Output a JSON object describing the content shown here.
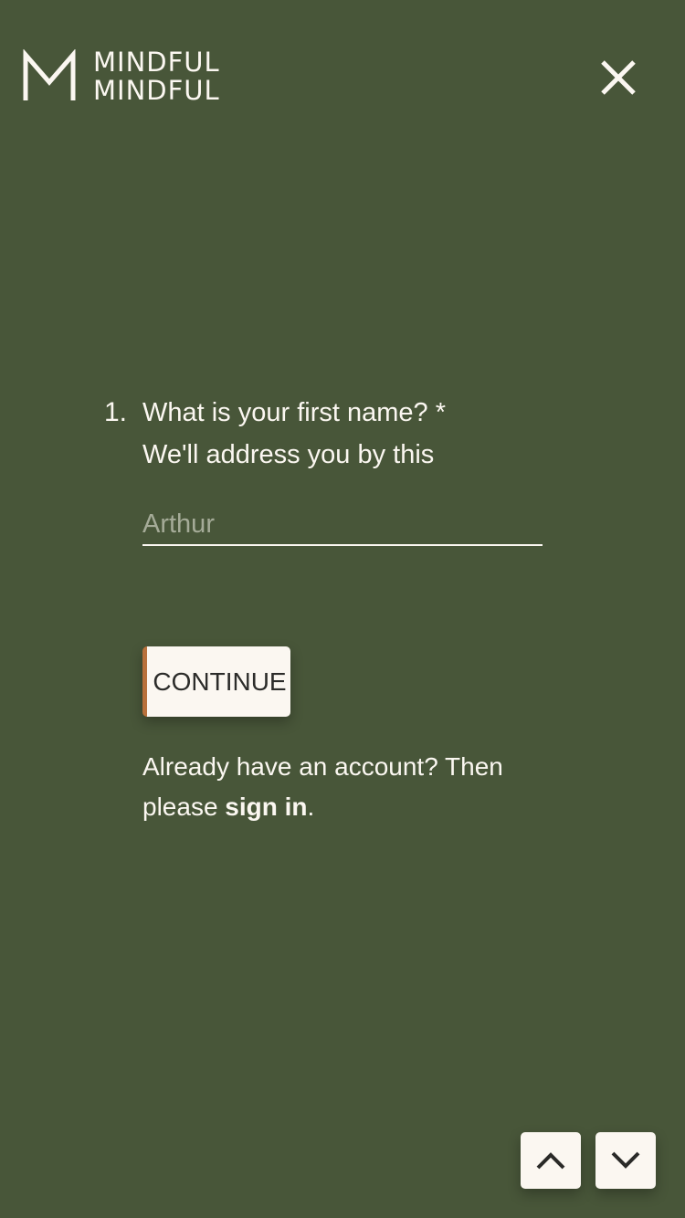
{
  "brand": {
    "wordmark_line1": "MINDFUL",
    "wordmark_line2": "MINDFUL"
  },
  "question": {
    "number": "1.",
    "title": "What is your first name? *",
    "subtitle": "We'll address you by this",
    "input_value": "",
    "input_placeholder": "Arthur"
  },
  "actions": {
    "continue_label": "CONTINUE",
    "signin_prefix": "Already have an account? Then please ",
    "signin_link": "sign in",
    "signin_suffix": "."
  },
  "icons": {
    "close": "close-icon",
    "up": "chevron-up-icon",
    "down": "chevron-down-icon"
  },
  "colors": {
    "background": "#485639",
    "foreground": "#fbf7f1",
    "button_bg": "#fbf7f1",
    "accent": "#b8713c"
  }
}
